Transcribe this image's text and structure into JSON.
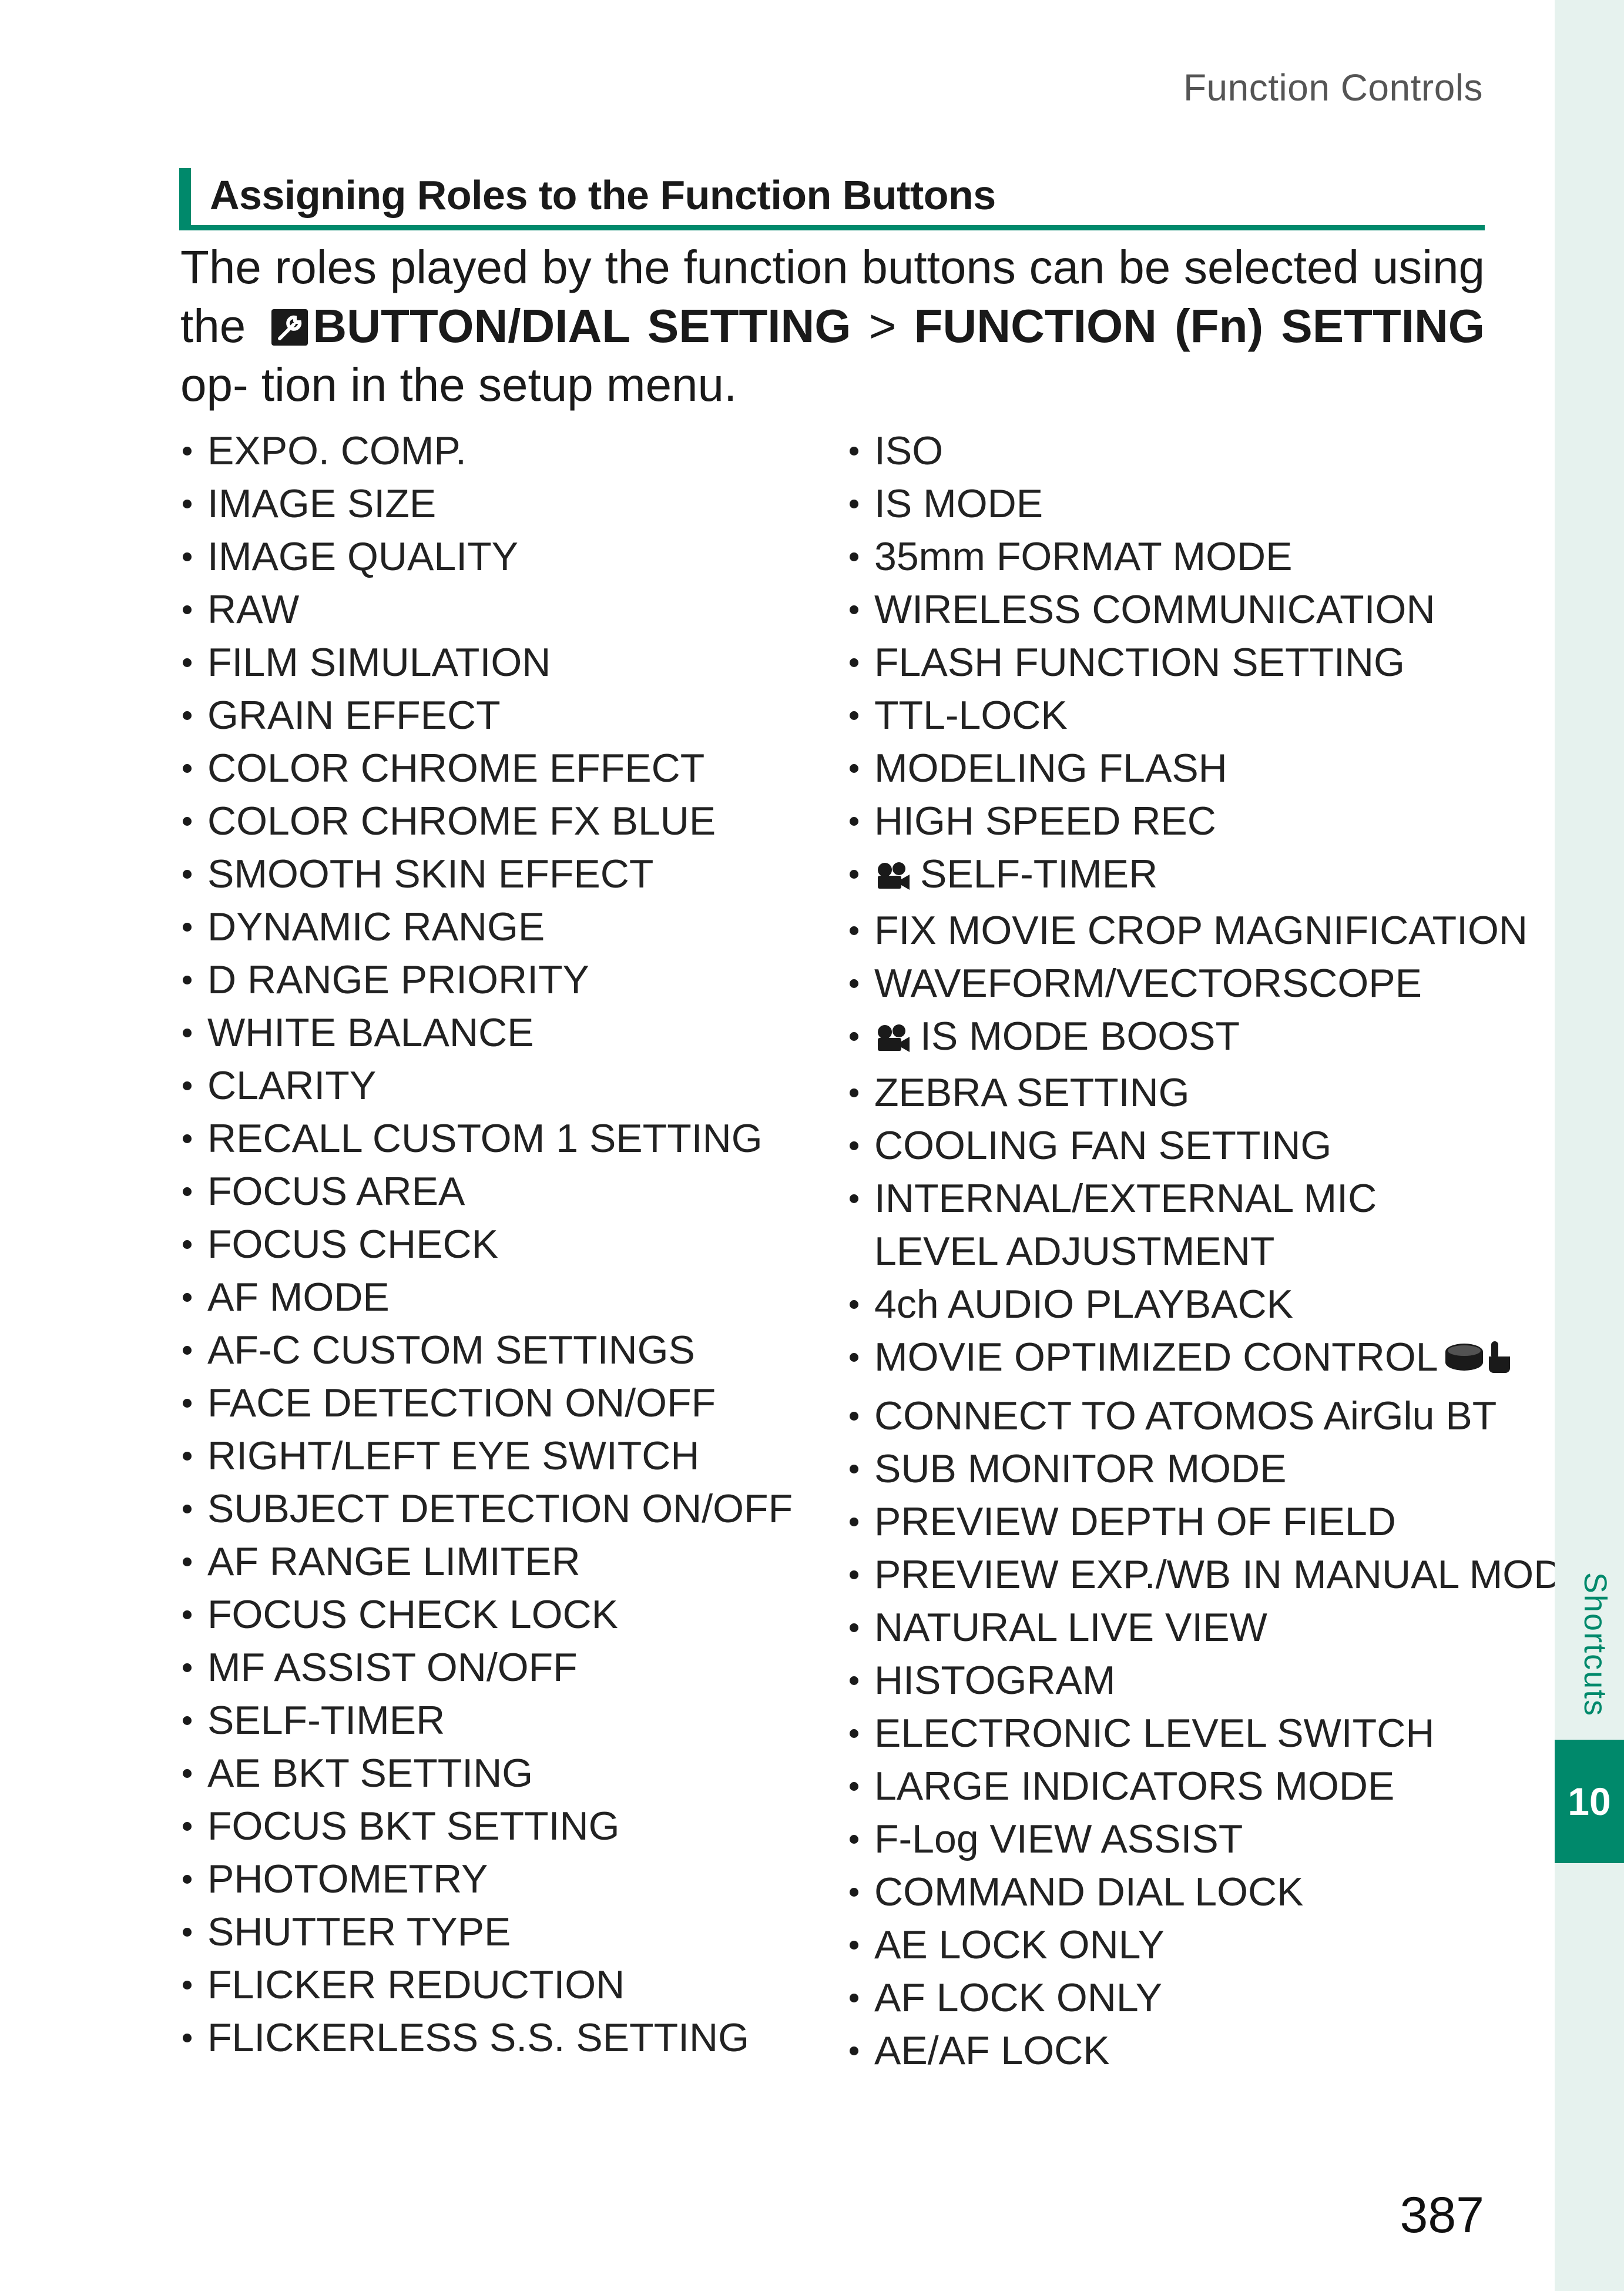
{
  "header": {
    "title": "Function Controls"
  },
  "section": {
    "title": "Assigning Roles to the Function Buttons"
  },
  "intro": {
    "text1": "The roles played by the function buttons can be selected using the ",
    "menu1": "BUTTON/DIAL SETTING",
    "sep": " > ",
    "menu2": "FUNCTION (Fn) SETTING",
    "text2": " op- tion in the setup menu."
  },
  "icons": {
    "setup": "wrench-setup-icon",
    "movie": "movie-camera-icon",
    "dial_touch": "dial-touch-icon"
  },
  "left_items": [
    "EXPO. COMP.",
    "IMAGE SIZE",
    "IMAGE QUALITY",
    "RAW",
    "FILM SIMULATION",
    "GRAIN EFFECT",
    "COLOR CHROME EFFECT",
    "COLOR CHROME FX BLUE",
    "SMOOTH SKIN EFFECT",
    "DYNAMIC RANGE",
    "D RANGE PRIORITY",
    "WHITE BALANCE",
    "CLARITY",
    "RECALL CUSTOM 1 SETTING",
    "FOCUS AREA",
    "FOCUS CHECK",
    "AF MODE",
    "AF-C CUSTOM SETTINGS",
    "FACE DETECTION ON/OFF",
    "RIGHT/LEFT EYE SWITCH",
    "SUBJECT DETECTION ON/OFF",
    "AF RANGE LIMITER",
    "FOCUS CHECK LOCK",
    "MF ASSIST ON/OFF",
    "SELF-TIMER",
    "AE BKT SETTING",
    "FOCUS BKT SETTING",
    "PHOTOMETRY",
    "SHUTTER TYPE",
    "FLICKER REDUCTION",
    "FLICKERLESS S.S. SETTING"
  ],
  "right_items": [
    "ISO",
    "IS MODE",
    "35mm FORMAT MODE",
    "WIRELESS COMMUNICATION",
    "FLASH FUNCTION SETTING",
    "TTL-LOCK",
    "MODELING FLASH",
    "HIGH SPEED REC",
    "SELF-TIMER",
    "FIX MOVIE CROP MAGNIFICATION",
    "WAVEFORM/VECTORSCOPE",
    "IS MODE BOOST",
    "ZEBRA SETTING",
    "COOLING FAN SETTING",
    "INTERNAL/EXTERNAL MIC LEVEL ADJUSTMENT",
    "4ch AUDIO PLAYBACK",
    "MOVIE OPTIMIZED CONTROL",
    "CONNECT TO ATOMOS AirGlu BT",
    "SUB MONITOR MODE",
    "PREVIEW DEPTH OF FIELD",
    "PREVIEW EXP./WB IN MANUAL MODE",
    "NATURAL LIVE VIEW",
    "HISTOGRAM",
    "ELECTRONIC LEVEL SWITCH",
    "LARGE INDICATORS MODE",
    "F-Log VIEW ASSIST",
    "COMMAND DIAL LOCK",
    "AE LOCK ONLY",
    "AF LOCK ONLY",
    "AE/AF LOCK"
  ],
  "sidebar": {
    "label": "Shortcuts",
    "chapter": "10"
  },
  "footer": {
    "page_number": "387"
  },
  "colors": {
    "accent": "#00896b",
    "sidebar_bg": "#e6f2ee"
  }
}
